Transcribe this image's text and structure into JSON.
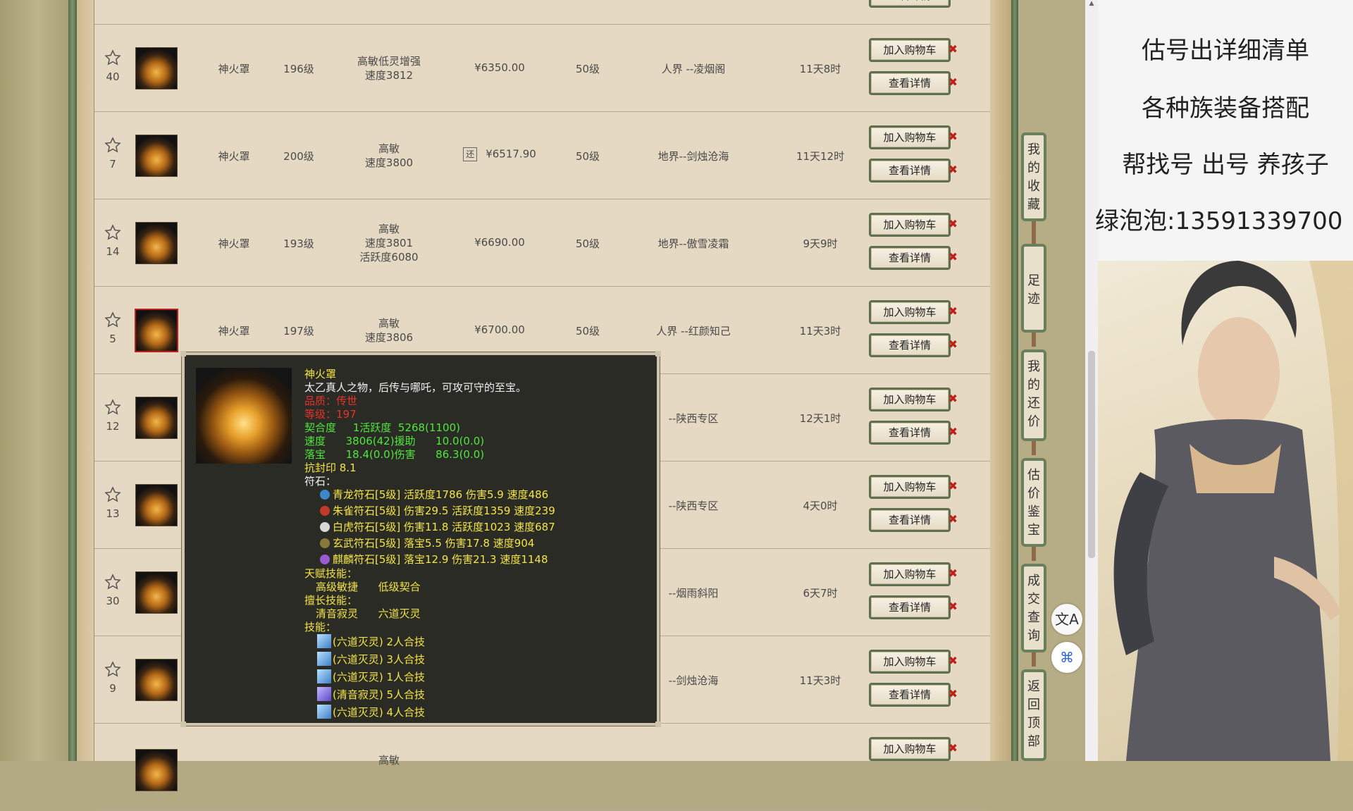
{
  "listing": {
    "add_label": "加入购物车",
    "detail_label": "查看详情",
    "rows": [
      {
        "rank": "",
        "name": "",
        "level": "",
        "attr": [],
        "price": "",
        "mlevel": "",
        "server": "",
        "time": ""
      },
      {
        "rank": "40",
        "name": "神火罩",
        "level": "196级",
        "attr": [
          "高敏低灵增强",
          "速度3812"
        ],
        "price": "¥6350.00",
        "mlevel": "50级",
        "server": "人界 --凌烟阁",
        "time": "11天8时"
      },
      {
        "rank": "7",
        "name": "神火罩",
        "level": "200级",
        "attr": [
          "高敏",
          "速度3800"
        ],
        "price": "¥6517.90",
        "refund": "还",
        "mlevel": "50级",
        "server": "地界--剑烛沧海",
        "time": "11天12时"
      },
      {
        "rank": "14",
        "name": "神火罩",
        "level": "193级",
        "attr": [
          "高敏",
          "速度3801",
          "活跃度6080"
        ],
        "price": "¥6690.00",
        "mlevel": "50级",
        "server": "地界--傲雪凌霜",
        "time": "9天9时"
      },
      {
        "rank": "5",
        "name": "神火罩",
        "level": "197级",
        "attr": [
          "高敏",
          "速度3806"
        ],
        "price": "¥6700.00",
        "mlevel": "50级",
        "server": "人界 --红颜知己",
        "time": "11天3时"
      },
      {
        "rank": "12",
        "name": "",
        "level": "",
        "attr": [],
        "price": "",
        "mlevel": "",
        "server": "--陕西专区",
        "time": "12天1时"
      },
      {
        "rank": "13",
        "name": "",
        "level": "",
        "attr": [],
        "price": "",
        "mlevel": "",
        "server": "--陕西专区",
        "time": "4天0时"
      },
      {
        "rank": "30",
        "name": "",
        "level": "",
        "attr": [],
        "price": "",
        "mlevel": "",
        "server": "--烟雨斜阳",
        "time": "6天7时"
      },
      {
        "rank": "9",
        "name": "",
        "level": "",
        "attr": [],
        "price": "",
        "mlevel": "",
        "server": "--剑烛沧海",
        "time": "11天3时"
      },
      {
        "rank": "",
        "name": "",
        "level": "",
        "attr": [
          "高敏"
        ],
        "price": "",
        "mlevel": "",
        "server": "",
        "time": ""
      }
    ]
  },
  "side_nav": {
    "favorites": "我的收藏",
    "footprint": "足迹",
    "my_offers": "我的还价",
    "appraisal": "估价鉴宝",
    "deals": "成交查询",
    "back_top": "返回顶部"
  },
  "ad": {
    "lines": [
      "估号出详细清单",
      "各种族装备搭配",
      "帮找号 出号 养孩子",
      "绿泡泡:13591339700"
    ]
  },
  "tooltip": {
    "title": "神火罩",
    "desc": "太乙真人之物，后传与哪吒，可攻可守的至宝。",
    "rarity": "品质：传世",
    "level": "等级：197",
    "stats": [
      "契合度     1活跃度  5268(1100)",
      "速度      3806(42)援助      10.0(0.0)",
      "落宝      18.4(0.0)伤害      86.3(0.0)",
      "抗封印 8.1"
    ],
    "rune_title": "符石：",
    "runes": [
      {
        "text": "青龙符石[5级] 活跃度1786 伤害5.9 速度486",
        "color": "#3b87c9"
      },
      {
        "text": "朱雀符石[5级] 伤害29.5 活跃度1359 速度239",
        "color": "#c43a2a"
      },
      {
        "text": "白虎符石[5级] 伤害11.8 活跃度1023 速度687",
        "color": "#d8d8d8"
      },
      {
        "text": "玄武符石[5级] 落宝5.5 伤害17.8 速度904",
        "color": "#8a7a3a"
      },
      {
        "text": "麒麟符石[5级] 落宝12.9 伤害21.3 速度1148",
        "color": "#9a5ad0"
      }
    ],
    "talent_title": "天赋技能：",
    "talents": "高级敏捷      低级契合",
    "expert_title": "擅长技能：",
    "experts": "清音寂灵      六道灭灵",
    "skill_title": "技能：",
    "skills": [
      "(六道灭灵) 2人合技",
      "(六道灭灵) 3人合技",
      "(六道灭灵) 1人合技",
      "(清音寂灵) 5人合技",
      "(六道灭灵) 4人合技"
    ]
  },
  "icons": {
    "star": "star-outline-icon",
    "translate": "translate-icon",
    "network": "network-icon"
  },
  "colors": {
    "accent_red": "#c0201a",
    "frame_green": "#5f7052",
    "tooltip_yellow": "#f3e447",
    "tooltip_green": "#4fe63d"
  }
}
